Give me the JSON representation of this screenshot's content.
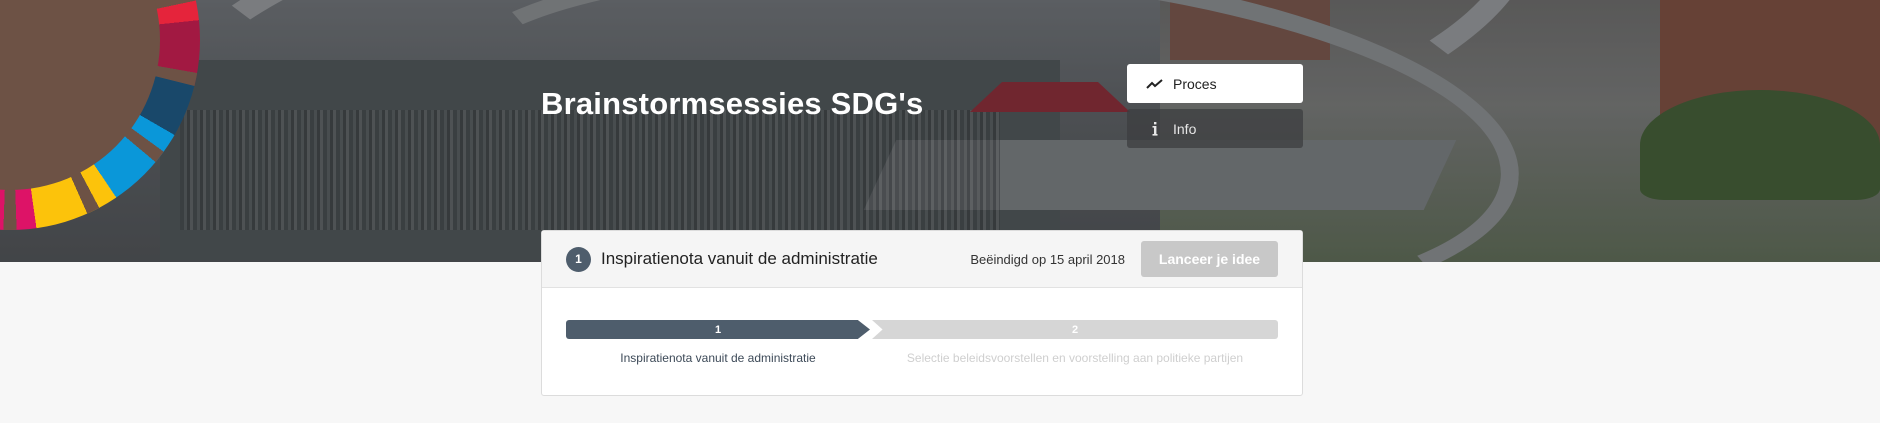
{
  "project": {
    "title": "Brainstormsessies SDG's"
  },
  "tabs": [
    {
      "label": "Proces",
      "icon": "trend-line-icon",
      "active": true
    },
    {
      "label": "Info",
      "icon": "info-icon",
      "active": false
    }
  ],
  "phase": {
    "number": "1",
    "title": "Inspiratienota vanuit de administratie",
    "status": "Beëindigd op 15 april 2018",
    "cta_label": "Lanceer je idee"
  },
  "timeline": {
    "steps": [
      {
        "number": "1",
        "label": "Inspiratienota vanuit de administratie",
        "active": true
      },
      {
        "number": "2",
        "label": "Selectie beleidsvoorstellen en voorstelling aan politieke partijen",
        "active": false
      }
    ]
  },
  "colors": {
    "accent": "#4e5d6c",
    "inactive": "#d6d6d6",
    "button_disabled": "#c8c8c8"
  }
}
